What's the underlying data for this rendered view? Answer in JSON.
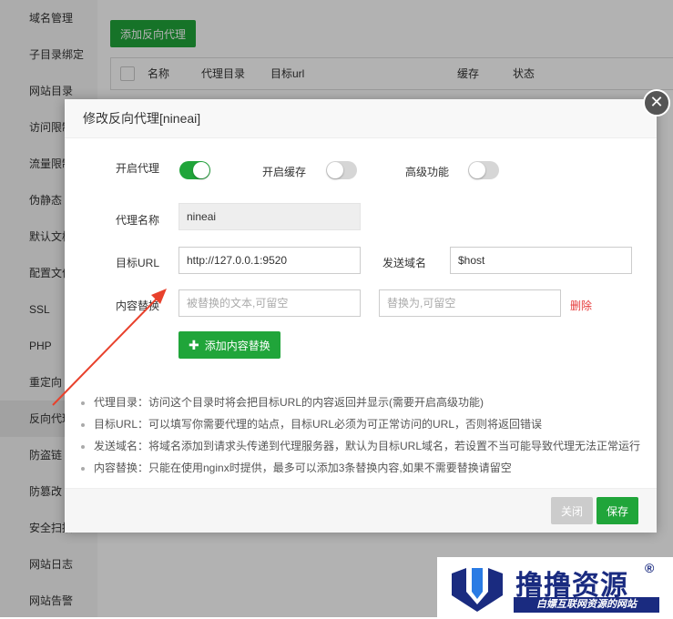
{
  "sidebar": {
    "items": [
      {
        "label": "域名管理"
      },
      {
        "label": "子目录绑定"
      },
      {
        "label": "网站目录"
      },
      {
        "label": "访问限制"
      },
      {
        "label": "流量限制"
      },
      {
        "label": "伪静态"
      },
      {
        "label": "默认文档"
      },
      {
        "label": "配置文件"
      },
      {
        "label": "SSL"
      },
      {
        "label": "PHP"
      },
      {
        "label": "重定向"
      },
      {
        "label": "反向代理"
      },
      {
        "label": "防盗链"
      },
      {
        "label": "防篡改"
      },
      {
        "label": "安全扫描"
      },
      {
        "label": "网站日志"
      },
      {
        "label": "网站告警"
      }
    ]
  },
  "main": {
    "add_proxy_label": "添加反向代理",
    "table_headers": [
      "名称",
      "代理目录",
      "目标url",
      "缓存",
      "状态"
    ]
  },
  "modal": {
    "title": "修改反向代理[nineai]",
    "close_icon": "close-icon",
    "toggles": {
      "enable_proxy": {
        "label": "开启代理",
        "on": true
      },
      "enable_cache": {
        "label": "开启缓存",
        "on": false
      },
      "advanced": {
        "label": "高级功能",
        "on": false
      }
    },
    "proxy_name": {
      "label": "代理名称",
      "value": "nineai"
    },
    "target_url": {
      "label": "目标URL",
      "value": "http://127.0.0.1:9520"
    },
    "send_domain": {
      "label": "发送域名",
      "value": "$host"
    },
    "content_replace": {
      "label": "内容替换",
      "from_placeholder": "被替换的文本,可留空",
      "to_placeholder": "替换为,可留空",
      "delete_label": "删除"
    },
    "add_replace_label": "添加内容替换",
    "tips": [
      "代理目录：访问这个目录时将会把目标URL的内容返回并显示(需要开启高级功能)",
      "目标URL：可以填写你需要代理的站点，目标URL必须为可正常访问的URL，否则将返回错误",
      "发送域名：将域名添加到请求头传递到代理服务器，默认为目标URL域名，若设置不当可能导致代理无法正常运行",
      "内容替换：只能在使用nginx时提供，最多可以添加3条替换内容,如果不需要替换请留空"
    ],
    "footer": {
      "close_label": "关闭",
      "save_label": "保存"
    }
  },
  "watermark": {
    "title": "撸撸资源",
    "registered": "®",
    "subtitle": "白嫖互联网资源的网站"
  },
  "colors": {
    "accent": "#20a53a",
    "danger": "#e63b3b",
    "annotation_arrow": "#e8412c",
    "watermark_blue": "#1a2b80"
  }
}
